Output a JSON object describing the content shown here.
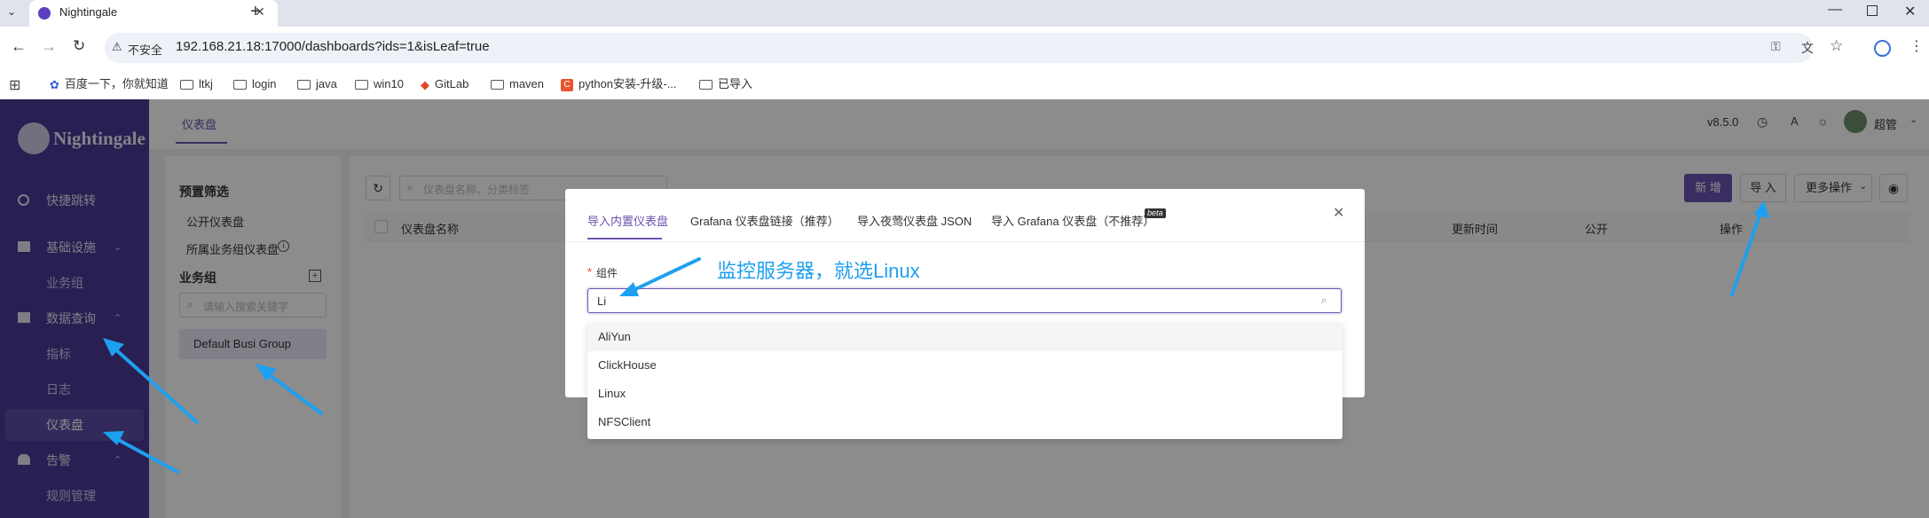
{
  "browser": {
    "tab_title": "Nightingale",
    "url_warning": "不安全",
    "url": "192.168.21.18:17000/dashboards?ids=1&isLeaf=true",
    "bookmarks": [
      "百度一下，你就知道",
      "ltkj",
      "login",
      "java",
      "win10",
      "GitLab",
      "maven",
      "python安装-升级-...",
      "已导入"
    ]
  },
  "app": {
    "logo_text": "Nightingale",
    "version": "v8.5.0",
    "username": "超管",
    "header_tab": "仪表盘"
  },
  "sidebar": {
    "items": [
      {
        "label": "快捷跳转"
      },
      {
        "label": "基础设施"
      },
      {
        "label": "业务组"
      },
      {
        "label": "数据查询"
      },
      {
        "label": "指标"
      },
      {
        "label": "日志"
      },
      {
        "label": "仪表盘"
      },
      {
        "label": "告警"
      },
      {
        "label": "规则管理"
      }
    ]
  },
  "left_panel": {
    "preset_title": "预置筛选",
    "preset_public": "公开仪表盘",
    "preset_all": "所属业务组仪表盘",
    "busi_title": "业务组",
    "search_placeholder": "请输入搜索关键字",
    "group_item": "Default Busi Group"
  },
  "main": {
    "search_placeholder": "仪表盘名称、分类标签",
    "new_button": "新 增",
    "import_button": "导 入",
    "more_button": "更多操作",
    "columns": [
      "仪表盘名称",
      "更新时间",
      "公开",
      "操作"
    ]
  },
  "modal": {
    "tabs": [
      "导入内置仪表盘",
      "Grafana 仪表盘链接（推荐）",
      "导入夜莺仪表盘 JSON",
      "导入 Grafana 仪表盘（不推荐）"
    ],
    "beta_badge": "beta",
    "field_required": "*",
    "field_label": "组件",
    "input_value": "Li",
    "options": [
      "AliYun",
      "ClickHouse",
      "Linux",
      "NFSClient"
    ]
  },
  "annotation": {
    "text": "监控服务器，就选Linux"
  },
  "colors": {
    "sidebar": "#4b3a98",
    "accent": "#6c53b1",
    "annotation": "#1ea0f0"
  }
}
